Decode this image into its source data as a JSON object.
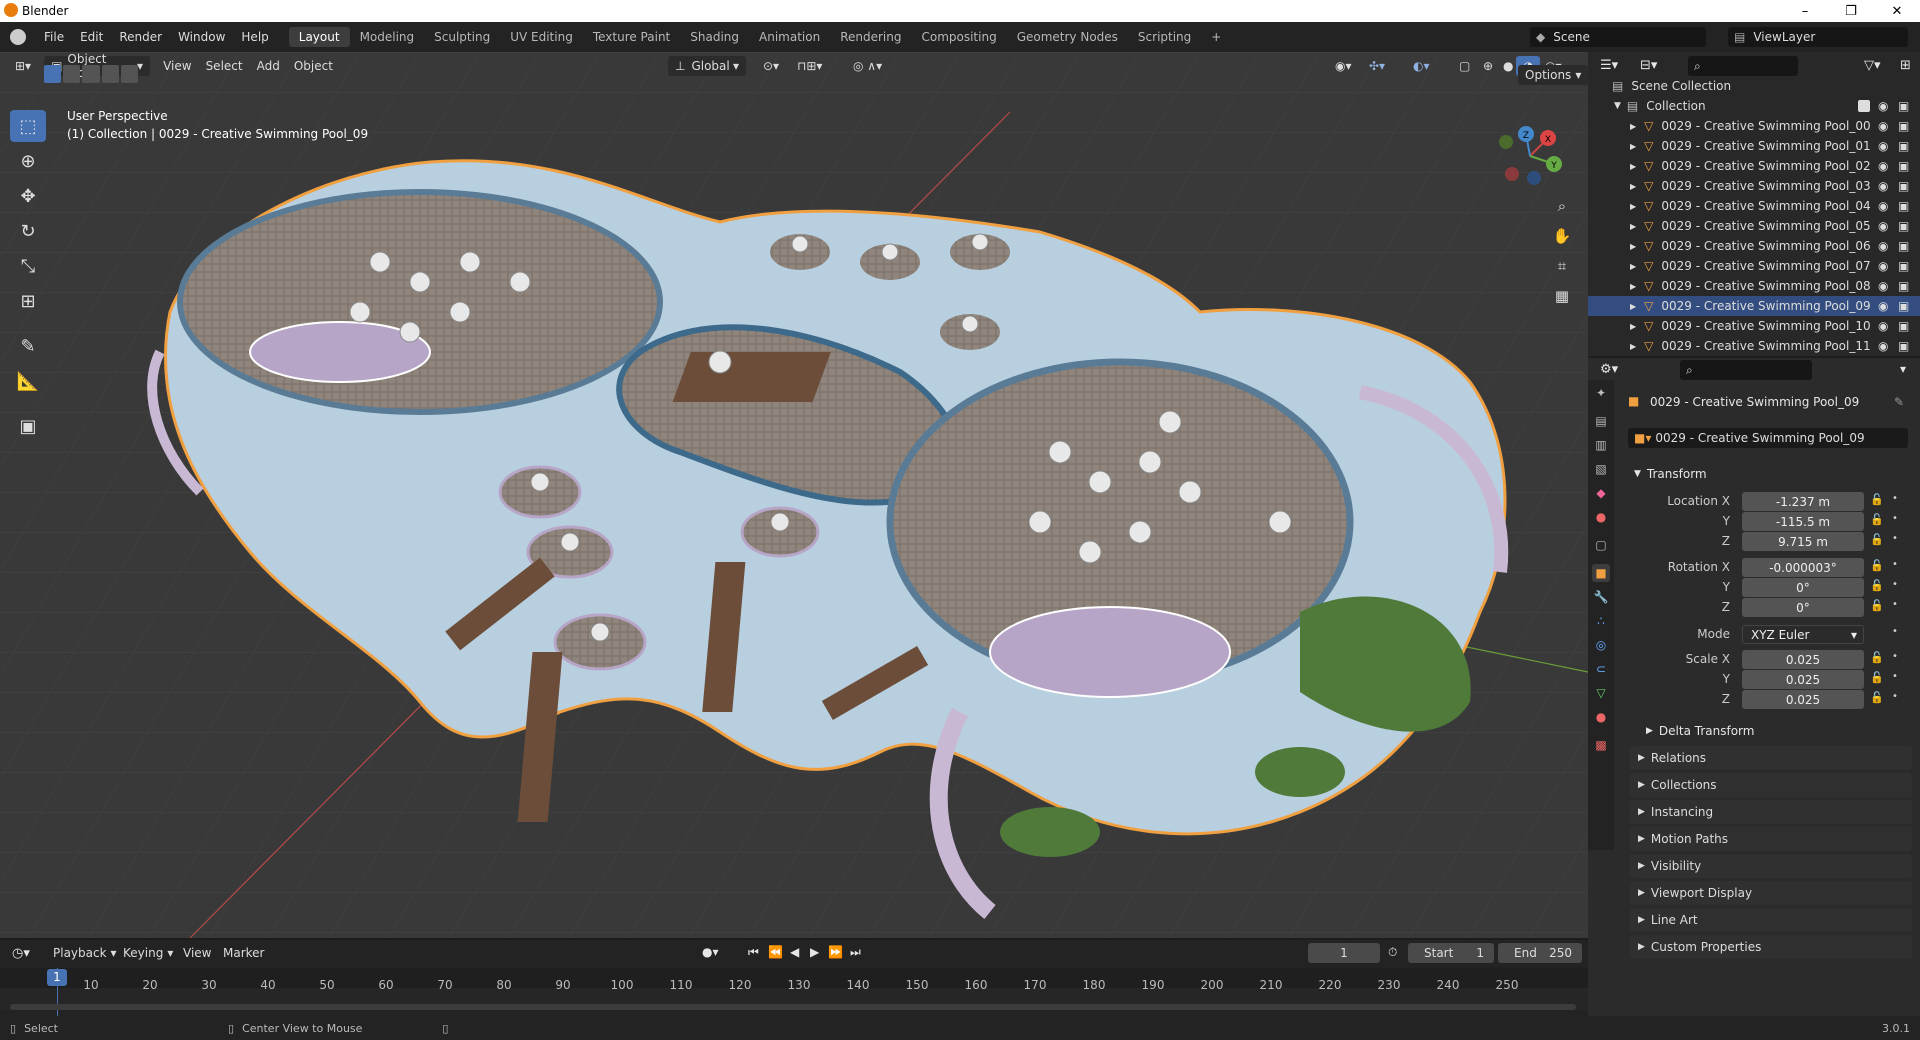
{
  "window": {
    "title": "Blender",
    "minimize": "–",
    "maximize": "❐",
    "close": "✕"
  },
  "menus": [
    "File",
    "Edit",
    "Render",
    "Window",
    "Help"
  ],
  "workspaces": [
    "Layout",
    "Modeling",
    "Sculpting",
    "UV Editing",
    "Texture Paint",
    "Shading",
    "Animation",
    "Rendering",
    "Compositing",
    "Geometry Nodes",
    "Scripting"
  ],
  "add_workspace": "+",
  "scene": {
    "label": "Scene",
    "view_layer": "ViewLayer"
  },
  "viewport": {
    "mode": "Object Mode",
    "menu": [
      "View",
      "Select",
      "Add",
      "Object"
    ],
    "transform_orientation": "Global",
    "options": "Options",
    "perspective_label": "User Perspective",
    "collection_label": "(1) Collection | 0029 - Creative Swimming Pool_09",
    "gizmo": {
      "x": "X",
      "y": "Y",
      "z": "Z"
    }
  },
  "tools": [
    "select-box-tool",
    "cursor-tool",
    "move-tool",
    "rotate-tool",
    "scale-tool",
    "transform-tool",
    "annotate-tool",
    "measure-tool",
    "add-cube-tool"
  ],
  "outliner": {
    "root": "Scene Collection",
    "collection": "Collection",
    "items": [
      "0029 - Creative Swimming Pool_00",
      "0029 - Creative Swimming Pool_01",
      "0029 - Creative Swimming Pool_02",
      "0029 - Creative Swimming Pool_03",
      "0029 - Creative Swimming Pool_04",
      "0029 - Creative Swimming Pool_05",
      "0029 - Creative Swimming Pool_06",
      "0029 - Creative Swimming Pool_07",
      "0029 - Creative Swimming Pool_08",
      "0029 - Creative Swimming Pool_09",
      "0029 - Creative Swimming Pool_10",
      "0029 - Creative Swimming Pool_11"
    ],
    "selected": "0029 - Creative Swimming Pool_09"
  },
  "properties": {
    "object_name": "0029 - Creative Swimming Pool_09",
    "object_field": "0029 - Creative Swimming Pool_09",
    "transform_title": "Transform",
    "location": {
      "label_x": "Location X",
      "label_y": "Y",
      "label_z": "Z",
      "x": "-1.237 m",
      "y": "-115.5 m",
      "z": "9.715 m"
    },
    "rotation": {
      "label_x": "Rotation X",
      "label_y": "Y",
      "label_z": "Z",
      "x": "-0.000003°",
      "y": "0°",
      "z": "0°"
    },
    "mode": {
      "label": "Mode",
      "value": "XYZ Euler"
    },
    "scale": {
      "label_x": "Scale X",
      "label_y": "Y",
      "label_z": "Z",
      "x": "0.025",
      "y": "0.025",
      "z": "0.025"
    },
    "delta": "Delta Transform",
    "sections": [
      "Relations",
      "Collections",
      "Instancing",
      "Motion Paths",
      "Visibility",
      "Viewport Display",
      "Line Art",
      "Custom Properties"
    ]
  },
  "timeline": {
    "menus": [
      "Playback",
      "Keying",
      "View",
      "Marker"
    ],
    "current_frame": "1",
    "start_label": "Start",
    "start": "1",
    "end_label": "End",
    "end": "250",
    "ruler": [
      "10",
      "20",
      "30",
      "40",
      "50",
      "60",
      "70",
      "80",
      "90",
      "100",
      "110",
      "120",
      "130",
      "140",
      "150",
      "160",
      "170",
      "180",
      "190",
      "200",
      "210",
      "220",
      "230",
      "240",
      "250"
    ],
    "playhead": "1"
  },
  "status": {
    "select": "Select",
    "center_view": "Center View to Mouse",
    "version": "3.0.1"
  },
  "colors": {
    "accent": "#4772b3",
    "selected_row": "#334d80",
    "orange_outline": "#f0a040",
    "water": "#b8cfe0",
    "deck": "#8a8078"
  }
}
